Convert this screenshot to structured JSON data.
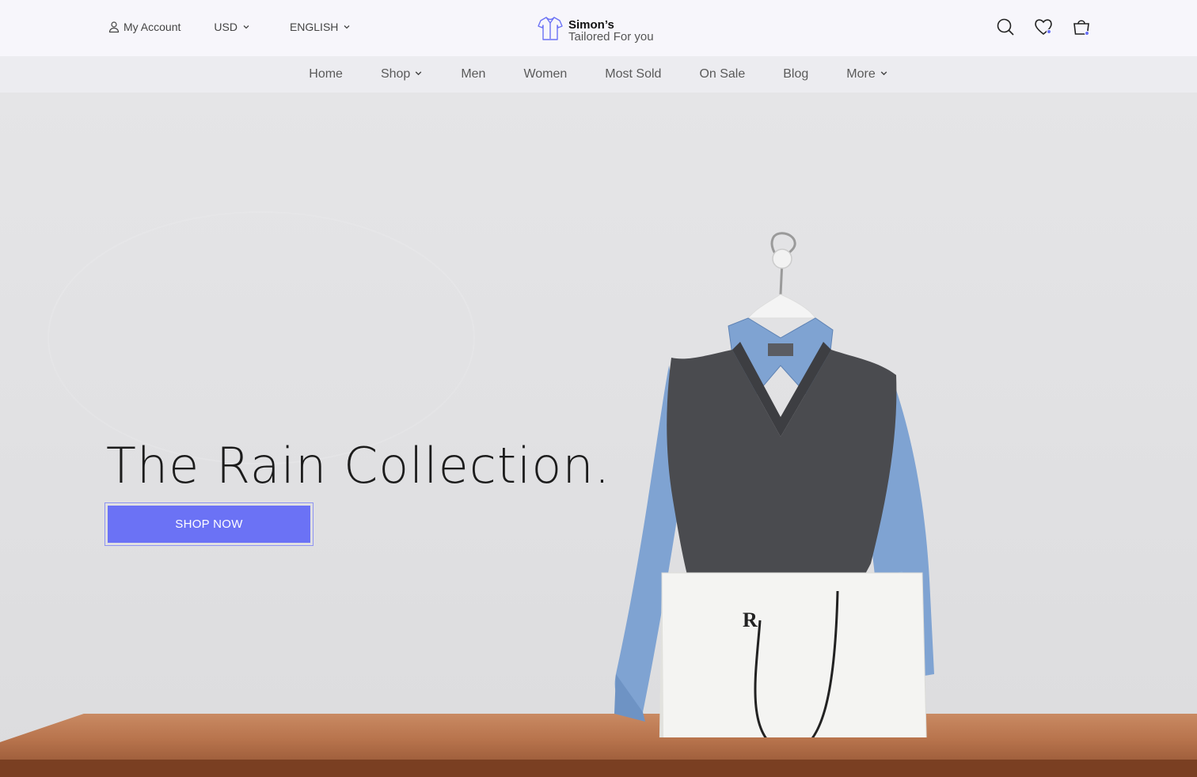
{
  "topbar": {
    "account_label": "My Account",
    "currency": "USD",
    "language": "ENGLISH"
  },
  "brand": {
    "name": "Simon’s",
    "tagline": "Tailored For you"
  },
  "nav": {
    "items": [
      {
        "label": "Home"
      },
      {
        "label": "Shop"
      },
      {
        "label": "Men"
      },
      {
        "label": "Women"
      },
      {
        "label": "Most Sold"
      },
      {
        "label": "On Sale"
      },
      {
        "label": "Blog"
      },
      {
        "label": "More"
      }
    ]
  },
  "hero": {
    "title": "The Rain Collection.",
    "cta_label": "SHOP NOW"
  },
  "colors": {
    "accent": "#6b72f5",
    "badge": "#6b72f5"
  }
}
